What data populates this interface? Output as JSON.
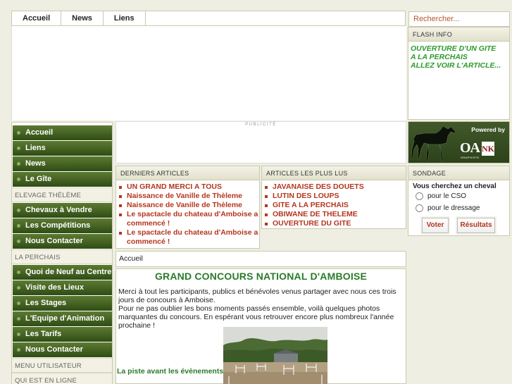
{
  "topnav": {
    "items": [
      "Accueil",
      "News",
      "Liens"
    ]
  },
  "search": {
    "placeholder": "Rechercher..."
  },
  "flash": {
    "title": "FLASH INFO",
    "lines": [
      "OUVERTURE D'UN GITE",
      "A LA PERCHAIS",
      "ALLEZ VOIR L'ARTICLE..."
    ]
  },
  "leftmenu": {
    "main": [
      "Accueil",
      "Liens",
      "News",
      "Le Gîte"
    ],
    "section1_title": "ELEVAGE THÉLÈME",
    "section1": [
      "Chevaux à Vendre",
      "Les Compétitions",
      "Nous Contacter"
    ],
    "section2_title": "LA PERCHAIS",
    "section2": [
      "Quoi de Neuf au Centre ?",
      "Visite des Lieux",
      "Les Stages",
      "L'Equipe d'Animation",
      "Les Tarifs",
      "Nous Contacter"
    ],
    "section3_title": "MENU UTILISATEUR",
    "section4_title": "QUI EST EN LIGNE"
  },
  "pub": {
    "label": "PUBLICITÉ"
  },
  "powered": {
    "label": "Powered by",
    "logo": "OA",
    "logo_sub": "GRAPHISTE",
    "logo2": "NK"
  },
  "derniers": {
    "title": "DERNIERS ARTICLES",
    "items": [
      "UN GRAND MERCI A TOUS",
      "Naissance de Vanille de Thèleme",
      "Naissance de Vanille de Thèleme",
      "Le spactacle du chateau d'Amboise a commencé !",
      "Le spactacle du chateau d'Amboise a commencé !"
    ]
  },
  "pluslus": {
    "title": "ARTICLES LES PLUS LUS",
    "items": [
      "JAVANAISE DES DOUETS",
      "LUTIN DES LOUPS",
      "GITE A LA PERCHAIS",
      "OBIWANE DE THELEME",
      "OUVERTURE DU GITE"
    ]
  },
  "sondage": {
    "title": "SONDAGE",
    "question": "Vous cherchez un cheval",
    "options": [
      "pour le CSO",
      "pour le dressage"
    ],
    "vote_label": "Voter",
    "results_label": "Résultats"
  },
  "breadcrumb": "Accueil",
  "content": {
    "title": "GRAND CONCOURS NATIONAL D'AMBOISE",
    "p1": "Merci à tout les participants, publics et bénévoles venus partager avec nous ces trois jours de concours à Amboise.",
    "p2": "Pour ne pas oublier les bons moments passés ensemble, voilà quelques photos marquantes du concours. En espérant vous retrouver encore plus nombreux l'année prochaine !",
    "caption": "La piste avant les évènements"
  },
  "colors": {
    "menu_green": "#3f5c20",
    "link_red": "#b5351c",
    "flash_green": "#2a9a2a",
    "title_green": "#2a7a2a"
  }
}
